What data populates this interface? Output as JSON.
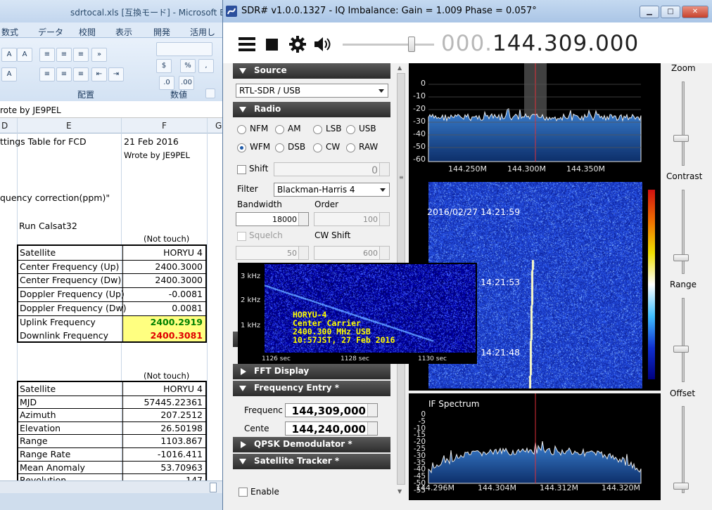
{
  "excel": {
    "title": "sdrtocal.xls  [互換モード] - Microsoft Excel",
    "tabs": [
      "数式",
      "データ",
      "校閲",
      "表示",
      "開発",
      "活用しよ"
    ],
    "groups": [
      "配置",
      "数値"
    ],
    "formula_bar": "rote by JE9PEL",
    "columns": [
      "D",
      "E",
      "F",
      "G"
    ],
    "cells": {
      "e1": "ttings Table for FCD",
      "f1": "21 Feb 2016",
      "f2": "Wrote by JE9PEL",
      "e3": "quency correction(ppm)\"",
      "e4": "Run Calsat32",
      "note1": "(Not touch)",
      "note2": "(Not touch)"
    },
    "table1": [
      [
        "Satellite",
        "HORYU 4"
      ],
      [
        "Center Frequency (Up)",
        "2400.3000"
      ],
      [
        "Center Frequency (Dw)",
        "2400.3000"
      ],
      [
        "Doppler Frequency (Up)",
        "-0.0081"
      ],
      [
        "Doppler Frequency (Dw)",
        "0.0081"
      ],
      [
        "Uplink Frequency",
        "2400.2919"
      ],
      [
        "Downlink Frequency",
        "2400.3081"
      ]
    ],
    "table2": [
      [
        "Satellite",
        "HORYU 4"
      ],
      [
        "MJD",
        "57445.22361"
      ],
      [
        "Azimuth",
        "207.2512"
      ],
      [
        "Elevation",
        "26.50198"
      ],
      [
        "Range",
        "1103.867"
      ],
      [
        "Range Rate",
        "-1016.411"
      ],
      [
        "Mean Anomaly",
        "53.70963"
      ],
      [
        "Revolution",
        "147"
      ]
    ]
  },
  "sdr": {
    "title": "SDR# v1.0.0.1327 - IQ Imbalance: Gain = 1.009 Phase = 0.057°",
    "freq_dim": "000.",
    "freq_main": "144.309.000",
    "sections": {
      "source": "Source",
      "radio": "Radio",
      "fft": "FFT Display",
      "freq_entry": "Frequency Entry *",
      "qpsk": "QPSK Demodulator *",
      "sat": "Satellite Tracker *"
    },
    "source_device": "RTL-SDR / USB",
    "modes": [
      "NFM",
      "AM",
      "LSB",
      "USB",
      "WFM",
      "DSB",
      "CW",
      "RAW"
    ],
    "selected_mode": "WFM",
    "shift_label": "Shift",
    "shift_value": "0",
    "filter_label": "Filter",
    "filter_value": "Blackman-Harris 4",
    "bandwidth_label": "Bandwidth",
    "bandwidth_value": "18000",
    "order_label": "Order",
    "order_value": "100",
    "squelch_label": "Squelch",
    "cwshift_label": "CW Shift",
    "squelch_value": "50",
    "cwshift_value": "600",
    "frequenc_label": "Frequenc",
    "frequenc_value": "144,309,000",
    "cente_label": "Cente",
    "cente_value": "144,240,000",
    "enable_label": "Enable",
    "spectrum": {
      "y_ticks": [
        "0",
        "-10",
        "-20",
        "-30",
        "-40",
        "-50",
        "-60"
      ],
      "x_ticks": [
        "144.250M",
        "144.300M",
        "144.350M"
      ]
    },
    "waterfall": {
      "timestamp": "2016/02/27 14:21:59",
      "t1": "14:21:53",
      "t2": "14:21:48"
    },
    "if_spectrum": {
      "title": "IF Spectrum",
      "y_ticks": [
        "0",
        "-5",
        "-10",
        "-15",
        "-20",
        "-25",
        "-30",
        "-35",
        "-40",
        "-45",
        "-50",
        "-55"
      ],
      "x_ticks": [
        "144.296M",
        "144.304M",
        "144.312M",
        "144.320M"
      ]
    },
    "sliders": [
      "Zoom",
      "Contrast",
      "Range",
      "Offset"
    ]
  },
  "overlay": {
    "y_ticks": [
      "3 kHz",
      "2 kHz",
      "1 kHz"
    ],
    "x_ticks": [
      "1126 sec",
      "1128 sec",
      "1130 sec"
    ],
    "lines": [
      "HORYU-4",
      "Center Carrier",
      "2400.300 MHz USB",
      "10:57JST, 27 Feb 2016"
    ]
  }
}
